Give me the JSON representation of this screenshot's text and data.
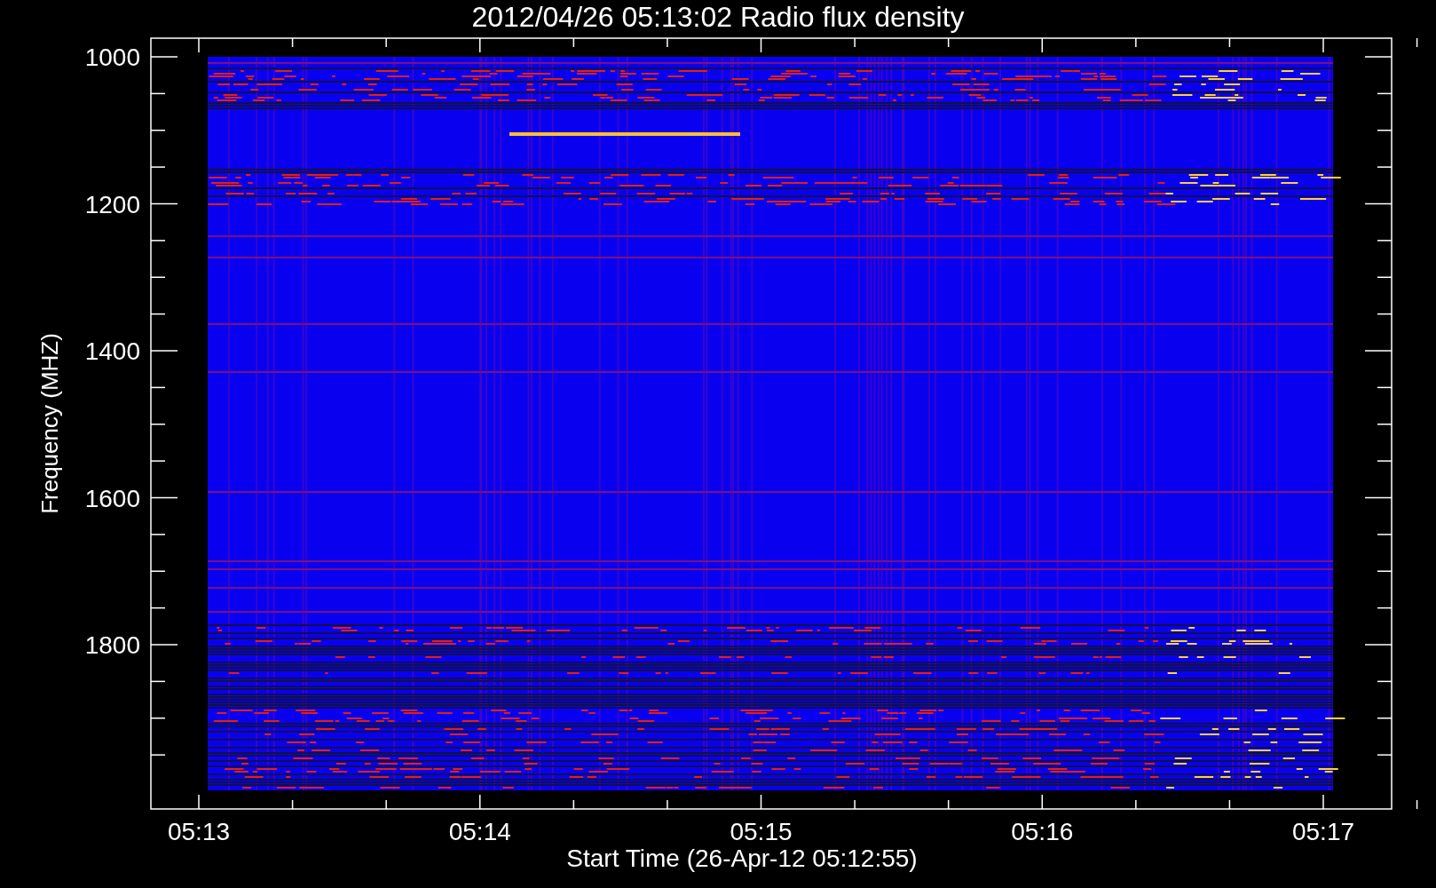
{
  "title": "2012/04/26 05:13:02 Radio flux density",
  "y_axis": {
    "label": "Frequency (MHZ)",
    "ticks": [
      "1000",
      "1200",
      "1400",
      "1600",
      "1800"
    ]
  },
  "x_axis": {
    "label": "Start Time (26-Apr-12 05:12:55)",
    "ticks": [
      "05:13",
      "05:14",
      "05:15",
      "05:16",
      "05:17"
    ]
  }
}
